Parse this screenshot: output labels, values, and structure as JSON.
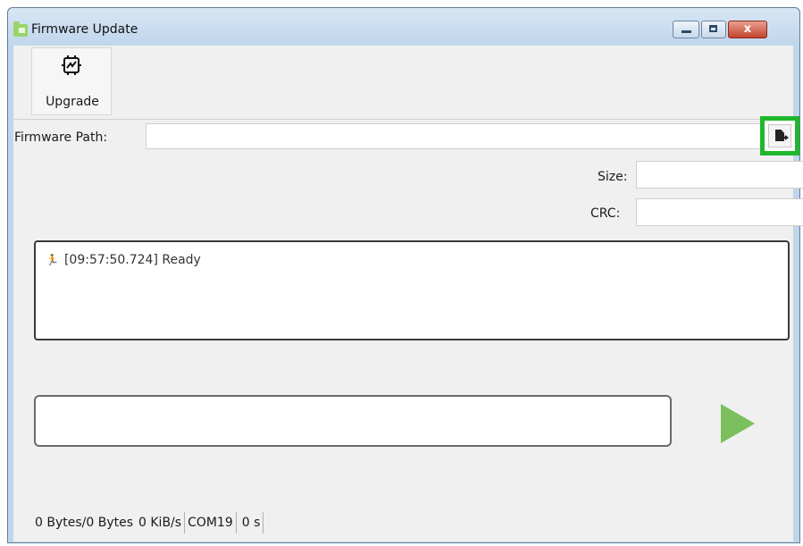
{
  "window": {
    "title": "Firmware Update",
    "close_glyph": "x"
  },
  "toolbar": {
    "upgrade_label": "Upgrade",
    "upgrade_icon": "firmware-chip-icon"
  },
  "form": {
    "firmware_path_label": "Firmware Path:",
    "firmware_path_value": "",
    "browse_icon": "open-file-icon",
    "size_label": "Size:",
    "size_value": "",
    "crc_label": "CRC:",
    "crc_value": ""
  },
  "log": {
    "entries": [
      {
        "icon": "running-man-icon",
        "text": "[09:57:50.724] Ready"
      }
    ]
  },
  "progress": {
    "value": 0,
    "start_icon": "play-icon"
  },
  "statusbar": {
    "bytes": "0 Bytes/0 Bytes",
    "speed": "0 KiB/s",
    "port": "COM19",
    "elapsed": "0 s"
  },
  "colors": {
    "highlight": "#1fb82a",
    "play": "#7bbf5e",
    "titlebar": "#c0d6ec"
  }
}
